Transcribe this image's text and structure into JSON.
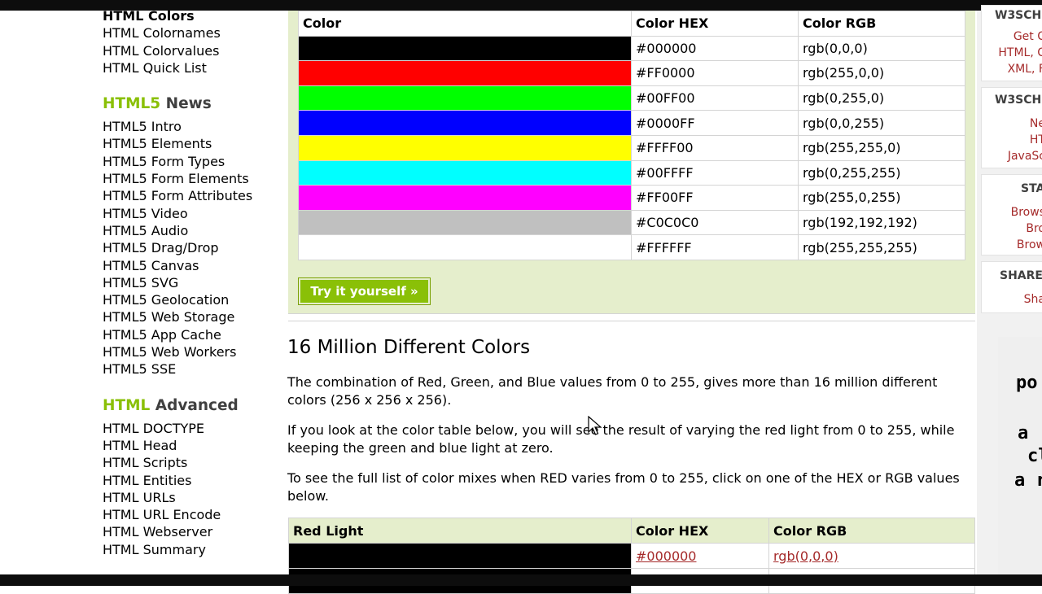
{
  "sidebar": {
    "top_links": [
      "HTML Colors",
      "HTML Colornames",
      "HTML Colorvalues",
      "HTML Quick List"
    ],
    "html5_heading": {
      "green": "HTML5",
      "rest": "News"
    },
    "html5_links": [
      "HTML5 Intro",
      "HTML5 Elements",
      "HTML5 Form Types",
      "HTML5 Form Elements",
      "HTML5 Form Attributes",
      "HTML5 Video",
      "HTML5 Audio",
      "HTML5 Drag/Drop",
      "HTML5 Canvas",
      "HTML5 SVG",
      "HTML5 Geolocation",
      "HTML5 Web Storage",
      "HTML5 App Cache",
      "HTML5 Web Workers",
      "HTML5 SSE"
    ],
    "advanced_heading": {
      "green": "HTML",
      "rest": "Advanced"
    },
    "advanced_links": [
      "HTML DOCTYPE",
      "HTML Head",
      "HTML Scripts",
      "HTML Entities",
      "HTML URLs",
      "HTML URL Encode",
      "HTML Webserver",
      "HTML Summary"
    ]
  },
  "color_table": {
    "headers": [
      "Color",
      "Color HEX",
      "Color RGB"
    ],
    "rows": [
      {
        "swatch": "#000000",
        "hex": "#000000",
        "rgb": "rgb(0,0,0)"
      },
      {
        "swatch": "#FF0000",
        "hex": "#FF0000",
        "rgb": "rgb(255,0,0)"
      },
      {
        "swatch": "#00FF00",
        "hex": "#00FF00",
        "rgb": "rgb(0,255,0)"
      },
      {
        "swatch": "#0000FF",
        "hex": "#0000FF",
        "rgb": "rgb(0,0,255)"
      },
      {
        "swatch": "#FFFF00",
        "hex": "#FFFF00",
        "rgb": "rgb(255,255,0)"
      },
      {
        "swatch": "#00FFFF",
        "hex": "#00FFFF",
        "rgb": "rgb(0,255,255)"
      },
      {
        "swatch": "#FF00FF",
        "hex": "#FF00FF",
        "rgb": "rgb(255,0,255)"
      },
      {
        "swatch": "#C0C0C0",
        "hex": "#C0C0C0",
        "rgb": "rgb(192,192,192)"
      },
      {
        "swatch": "#FFFFFF",
        "hex": "#FFFFFF",
        "rgb": "rgb(255,255,255)"
      }
    ]
  },
  "try_button": "Try it yourself »",
  "section": {
    "title": "16 Million Different Colors",
    "p1": "The combination of Red, Green, and Blue values from 0 to 255, gives more than 16 million different colors (256 x 256 x 256).",
    "p2": "If you look at the color table below, you will see the result of varying the red light from 0 to 255, while keeping the green and blue light at zero.",
    "p3": "To see the full list of color mixes when RED varies from 0 to 255, click on one of the HEX or RGB values below."
  },
  "red_table": {
    "headers": [
      "Red Light",
      "Color HEX",
      "Color RGB"
    ],
    "rows": [
      {
        "swatch": "#000000",
        "hex": "#000000",
        "rgb": "rgb(0,0,0)"
      }
    ]
  },
  "right_column": {
    "box1": {
      "heading": "W3SCH",
      "links": [
        "Get C",
        "HTML, C",
        "XML, F"
      ]
    },
    "box2": {
      "heading": "W3SCH",
      "links": [
        "Ne",
        "HT",
        "JavaSc"
      ]
    },
    "box3": {
      "heading": "STA",
      "links": [
        "Brows",
        "Bro",
        "Brow"
      ]
    },
    "box4": {
      "heading": "SHARE",
      "links": [
        "Sha"
      ]
    },
    "ad_text": [
      "po",
      "a",
      "cl",
      "a r"
    ]
  },
  "colors": {
    "accent_green": "#8ac007",
    "panel_bg": "#e5eecc",
    "link_red": "#a52a2a"
  }
}
